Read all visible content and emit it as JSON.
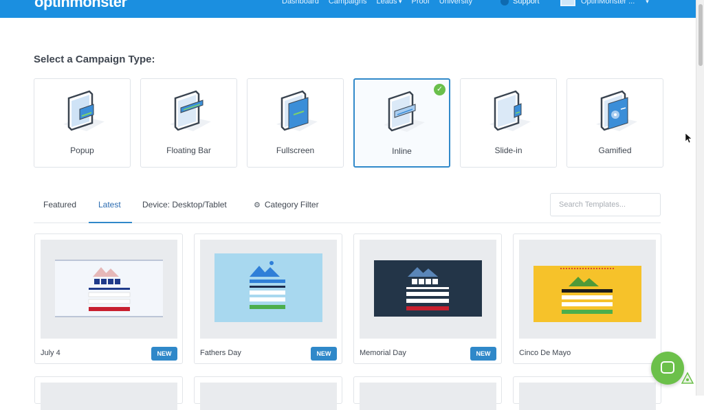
{
  "header": {
    "logo": "optinmonster",
    "nav": [
      "Dashboard",
      "Campaigns",
      "Leads",
      "Proof",
      "University"
    ],
    "support": "Support",
    "account": "OptinMonster ..."
  },
  "heading": "Select a Campaign Type:",
  "campaign_types": [
    {
      "label": "Popup",
      "selected": false
    },
    {
      "label": "Floating Bar",
      "selected": false
    },
    {
      "label": "Fullscreen",
      "selected": false
    },
    {
      "label": "Inline",
      "selected": true
    },
    {
      "label": "Slide-in",
      "selected": false
    },
    {
      "label": "Gamified",
      "selected": false
    }
  ],
  "tabs": {
    "featured": "Featured",
    "latest": "Latest",
    "device_label": "Device:",
    "device_value": "Desktop/Tablet",
    "category": "Category Filter"
  },
  "search": {
    "placeholder": "Search Templates..."
  },
  "templates": [
    {
      "name": "July 4",
      "badge": "NEW"
    },
    {
      "name": "Fathers Day",
      "badge": "NEW"
    },
    {
      "name": "Memorial Day",
      "badge": "NEW"
    },
    {
      "name": "Cinco De Mayo",
      "badge": ""
    }
  ],
  "colors": {
    "header": "#1b8fe0",
    "accent": "#2f88c9",
    "check": "#6abf4b",
    "chat": "#6cc04a"
  }
}
